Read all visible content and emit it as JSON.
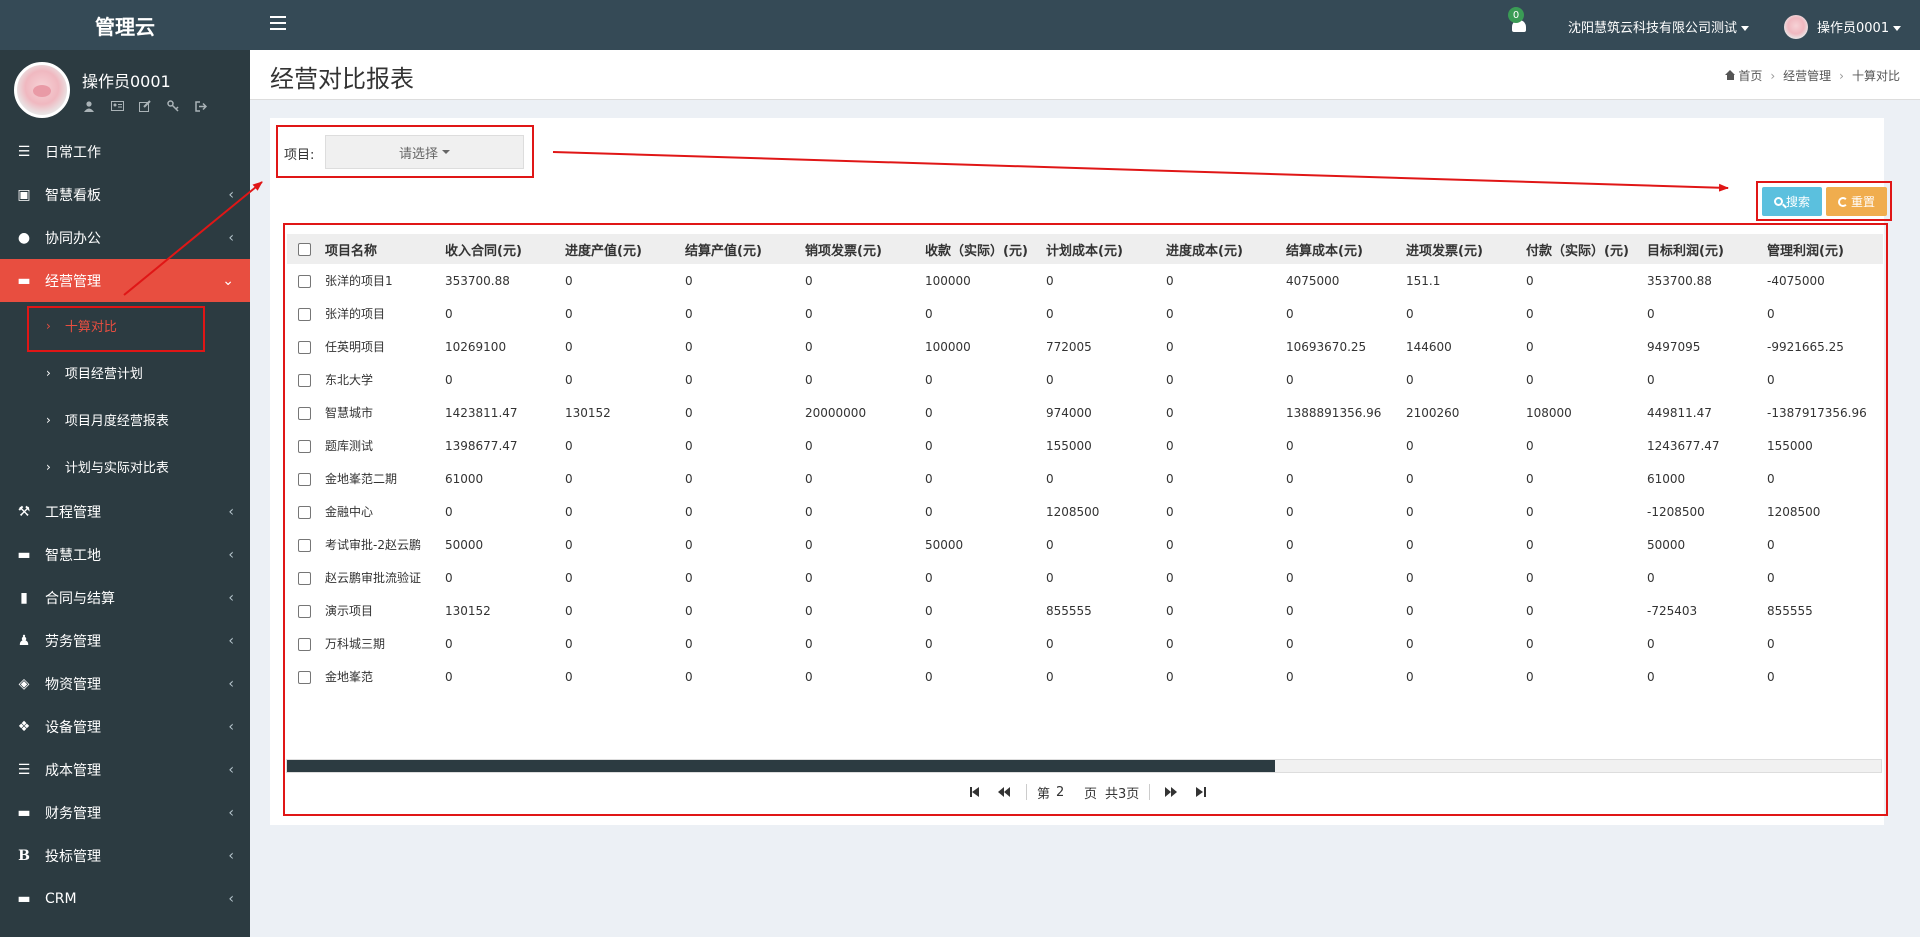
{
  "brand": "管理云",
  "user": {
    "name": "操作员0001"
  },
  "topbar": {
    "notification_count": "0",
    "company": "沈阳慧筑云科技有限公司测试",
    "username": "操作员0001"
  },
  "sidebar": {
    "items": [
      {
        "label": "日常工作",
        "icon": "list-icon"
      },
      {
        "label": "智慧看板",
        "icon": "dashboard-icon"
      },
      {
        "label": "协同办公",
        "icon": "users-icon"
      },
      {
        "label": "经营管理",
        "icon": "monitor-icon",
        "active": true
      },
      {
        "label": "工程管理",
        "icon": "gavel-icon"
      },
      {
        "label": "智慧工地",
        "icon": "monitor-icon"
      },
      {
        "label": "合同与结算",
        "icon": "file-icon"
      },
      {
        "label": "劳务管理",
        "icon": "worker-icon"
      },
      {
        "label": "物资管理",
        "icon": "cube-icon"
      },
      {
        "label": "设备管理",
        "icon": "cubes-icon"
      },
      {
        "label": "成本管理",
        "icon": "list-icon"
      },
      {
        "label": "财务管理",
        "icon": "monitor-icon"
      },
      {
        "label": "投标管理",
        "icon": "bold-icon"
      },
      {
        "label": "CRM",
        "icon": "monitor-icon"
      }
    ],
    "submenu": [
      {
        "label": "十算对比",
        "current": true
      },
      {
        "label": "项目经营计划"
      },
      {
        "label": "项目月度经营报表"
      },
      {
        "label": "计划与实际对比表"
      }
    ]
  },
  "page": {
    "title": "经营对比报表",
    "breadcrumb": [
      "首页",
      "经营管理",
      "十算对比"
    ]
  },
  "filter": {
    "label": "项目:",
    "select_placeholder": "请选择"
  },
  "buttons": {
    "search": "搜索",
    "reset": "重置"
  },
  "table": {
    "headers": [
      "项目名称",
      "收入合同(元)",
      "进度产值(元)",
      "结算产值(元)",
      "销项发票(元)",
      "收款（实际）(元)",
      "计划成本(元)",
      "进度成本(元)",
      "结算成本(元)",
      "进项发票(元)",
      "付款（实际）(元)",
      "目标利润(元)",
      "管理利润(元)"
    ],
    "rows": [
      [
        "张洋的项目1",
        "353700.88",
        "0",
        "0",
        "0",
        "100000",
        "0",
        "0",
        "4075000",
        "151.1",
        "0",
        "353700.88",
        "-4075000"
      ],
      [
        "张洋的项目",
        "0",
        "0",
        "0",
        "0",
        "0",
        "0",
        "0",
        "0",
        "0",
        "0",
        "0",
        "0"
      ],
      [
        "任英明项目",
        "10269100",
        "0",
        "0",
        "0",
        "100000",
        "772005",
        "0",
        "10693670.25",
        "144600",
        "0",
        "9497095",
        "-9921665.25"
      ],
      [
        "东北大学",
        "0",
        "0",
        "0",
        "0",
        "0",
        "0",
        "0",
        "0",
        "0",
        "0",
        "0",
        "0"
      ],
      [
        "智慧城市",
        "1423811.47",
        "130152",
        "0",
        "20000000",
        "0",
        "974000",
        "0",
        "1388891356.96",
        "2100260",
        "108000",
        "449811.47",
        "-1387917356.96"
      ],
      [
        "题库测试",
        "1398677.47",
        "0",
        "0",
        "0",
        "0",
        "155000",
        "0",
        "0",
        "0",
        "0",
        "1243677.47",
        "155000"
      ],
      [
        "金地峯范二期",
        "61000",
        "0",
        "0",
        "0",
        "0",
        "0",
        "0",
        "0",
        "0",
        "0",
        "61000",
        "0"
      ],
      [
        "金融中心",
        "0",
        "0",
        "0",
        "0",
        "0",
        "1208500",
        "0",
        "0",
        "0",
        "0",
        "-1208500",
        "1208500"
      ],
      [
        "考试审批-2赵云鹏",
        "50000",
        "0",
        "0",
        "0",
        "50000",
        "0",
        "0",
        "0",
        "0",
        "0",
        "50000",
        "0"
      ],
      [
        "赵云鹏审批流验证",
        "0",
        "0",
        "0",
        "0",
        "0",
        "0",
        "0",
        "0",
        "0",
        "0",
        "0",
        "0"
      ],
      [
        "演示项目",
        "130152",
        "0",
        "0",
        "0",
        "0",
        "855555",
        "0",
        "0",
        "0",
        "0",
        "-725403",
        "855555"
      ],
      [
        "万科城三期",
        "0",
        "0",
        "0",
        "0",
        "0",
        "0",
        "0",
        "0",
        "0",
        "0",
        "0",
        "0"
      ],
      [
        "金地峯范",
        "0",
        "0",
        "0",
        "0",
        "0",
        "0",
        "0",
        "0",
        "0",
        "0",
        "0",
        "0"
      ]
    ],
    "scroll_position": 0.62
  },
  "pager": {
    "prefix": "第",
    "current_page": "2",
    "page_suffix": "页",
    "total": "共3页"
  },
  "colors": {
    "sidebar_bg": "#2c3b41",
    "topbar_bg": "#354a56",
    "active": "#e84e40",
    "annotation": "#e01616",
    "search_btn": "#5bc0de",
    "reset_btn": "#f0ad4e"
  }
}
